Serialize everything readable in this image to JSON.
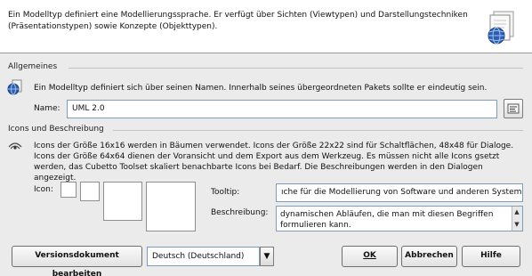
{
  "header": {
    "description": "Ein Modelltyp definiert eine Modellierungssprache. Er verfügt über Sichten (Viewtypen) und Darstellungstechniken (Präsentationstypen) sowie Konzepte (Objekttypen)."
  },
  "general": {
    "title": "Allgemeines",
    "info": "Ein Modelltyp definiert sich über seinen Namen. Innerhalb seines übergeordneten Pakets sollte er eindeutig sein.",
    "name_label": "Name:",
    "name_value": "UML 2.0"
  },
  "icons": {
    "title": "Icons und Beschreibung",
    "info": "Icons der Größe 16x16 werden in Bäumen verwendet. Icons der Größe 22x22 sind für Schaltflächen, 48x48 für Dialoge. Icons der Größe 64x64 dienen der Voransicht und dem Export aus dem Werkzeug. Es müssen nicht alle Icons gsetzt werden, das Cubetto Toolset skaliert benachbarte Icons bei Bedarf. Die Beschreibungen werden in den Dialogen angezeigt.",
    "icon_label": "Icon:",
    "tooltip_label": "Tooltip:",
    "tooltip_value": "ıche für die Modellierung von Software und anderen Systemen",
    "description_label": "Beschreibung:",
    "description_value": "dynamischen Abläufen, die man mit diesen Begriffen formulieren kann."
  },
  "footer": {
    "versions_button": "Versionsdokument bearbeiten",
    "language_value": "Deutsch (Deutschland)",
    "ok_button": "OK",
    "cancel_button": "Abbrechen",
    "help_button": "Hilfe"
  }
}
